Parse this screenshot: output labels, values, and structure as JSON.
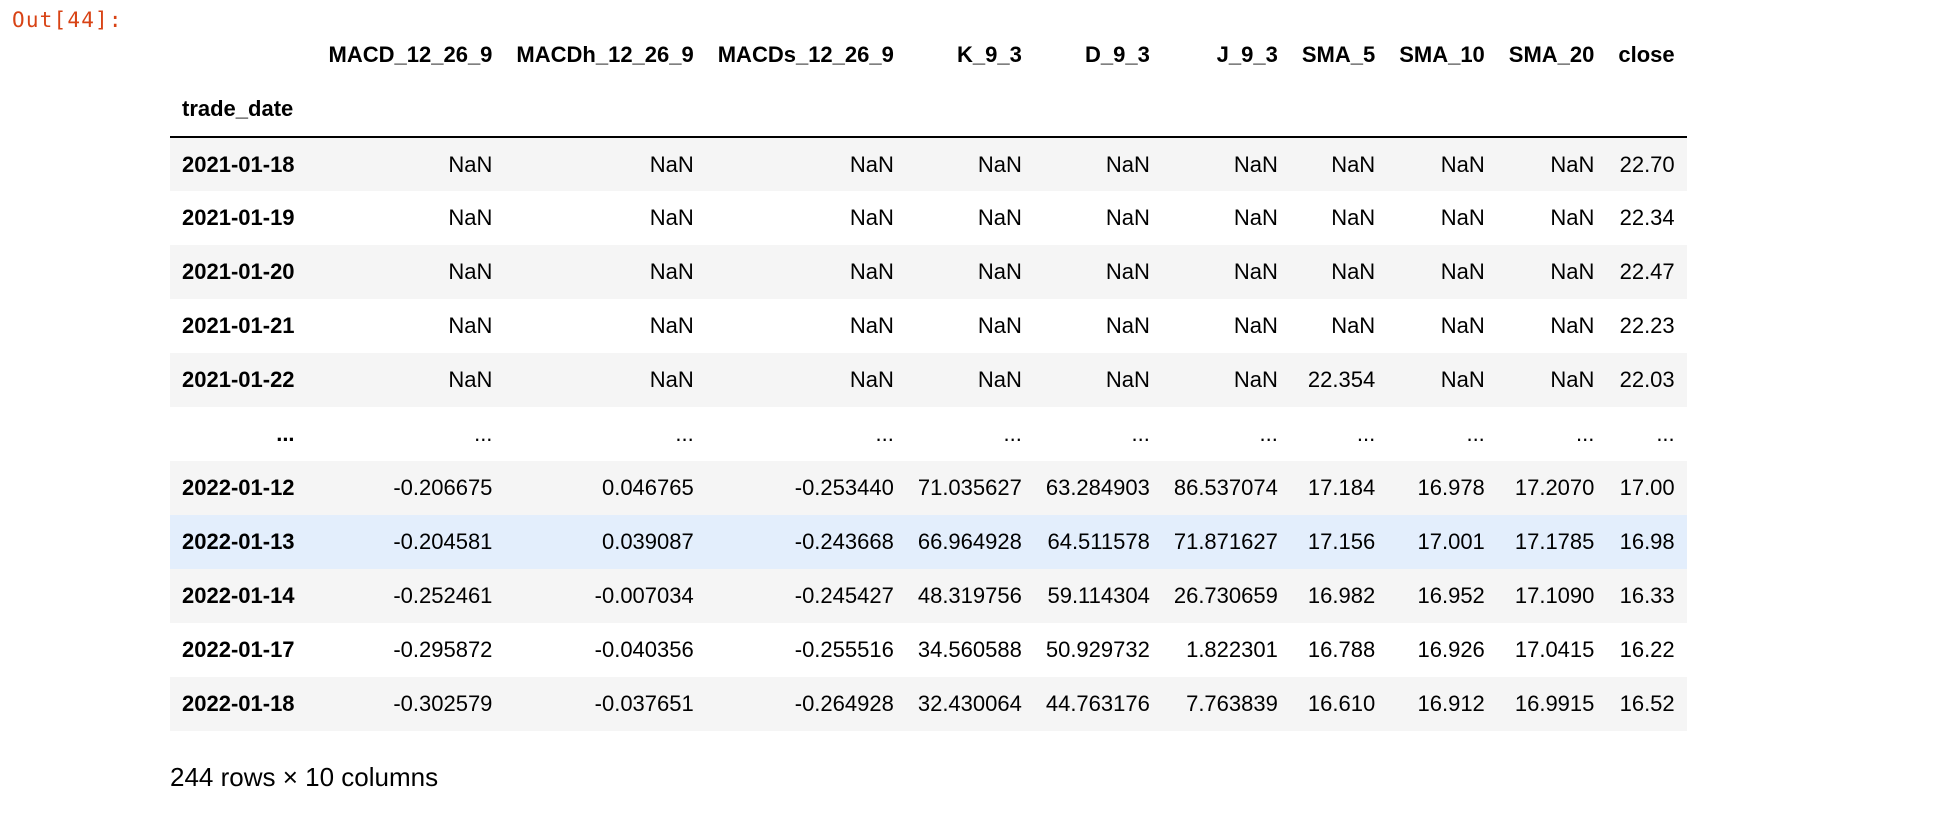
{
  "cell": {
    "output_prompt": "Out[44]:"
  },
  "dataframe": {
    "columns": [
      "MACD_12_26_9",
      "MACDh_12_26_9",
      "MACDs_12_26_9",
      "K_9_3",
      "D_9_3",
      "J_9_3",
      "SMA_5",
      "SMA_10",
      "SMA_20",
      "close"
    ],
    "index_name": "trade_date",
    "rows": [
      {
        "index": "2021-01-18",
        "values": [
          "NaN",
          "NaN",
          "NaN",
          "NaN",
          "NaN",
          "NaN",
          "NaN",
          "NaN",
          "NaN",
          "22.70"
        ]
      },
      {
        "index": "2021-01-19",
        "values": [
          "NaN",
          "NaN",
          "NaN",
          "NaN",
          "NaN",
          "NaN",
          "NaN",
          "NaN",
          "NaN",
          "22.34"
        ]
      },
      {
        "index": "2021-01-20",
        "values": [
          "NaN",
          "NaN",
          "NaN",
          "NaN",
          "NaN",
          "NaN",
          "NaN",
          "NaN",
          "NaN",
          "22.47"
        ]
      },
      {
        "index": "2021-01-21",
        "values": [
          "NaN",
          "NaN",
          "NaN",
          "NaN",
          "NaN",
          "NaN",
          "NaN",
          "NaN",
          "NaN",
          "22.23"
        ]
      },
      {
        "index": "2021-01-22",
        "values": [
          "NaN",
          "NaN",
          "NaN",
          "NaN",
          "NaN",
          "NaN",
          "22.354",
          "NaN",
          "NaN",
          "22.03"
        ]
      },
      {
        "index": "...",
        "values": [
          "...",
          "...",
          "...",
          "...",
          "...",
          "...",
          "...",
          "...",
          "...",
          "..."
        ]
      },
      {
        "index": "2022-01-12",
        "values": [
          "-0.206675",
          "0.046765",
          "-0.253440",
          "71.035627",
          "63.284903",
          "86.537074",
          "17.184",
          "16.978",
          "17.2070",
          "17.00"
        ]
      },
      {
        "index": "2022-01-13",
        "values": [
          "-0.204581",
          "0.039087",
          "-0.243668",
          "66.964928",
          "64.511578",
          "71.871627",
          "17.156",
          "17.001",
          "17.1785",
          "16.98"
        ],
        "highlight": true
      },
      {
        "index": "2022-01-14",
        "values": [
          "-0.252461",
          "-0.007034",
          "-0.245427",
          "48.319756",
          "59.114304",
          "26.730659",
          "16.982",
          "16.952",
          "17.1090",
          "16.33"
        ]
      },
      {
        "index": "2022-01-17",
        "values": [
          "-0.295872",
          "-0.040356",
          "-0.255516",
          "34.560588",
          "50.929732",
          "1.822301",
          "16.788",
          "16.926",
          "17.0415",
          "16.22"
        ]
      },
      {
        "index": "2022-01-18",
        "values": [
          "-0.302579",
          "-0.037651",
          "-0.264928",
          "32.430064",
          "44.763176",
          "7.763839",
          "16.610",
          "16.912",
          "16.9915",
          "16.52"
        ]
      }
    ],
    "shape_caption": "244 rows × 10 columns"
  },
  "colors": {
    "prompt": "#d84315",
    "row_stripe": "#f5f5f5",
    "row_hover": "#e3eefc"
  }
}
